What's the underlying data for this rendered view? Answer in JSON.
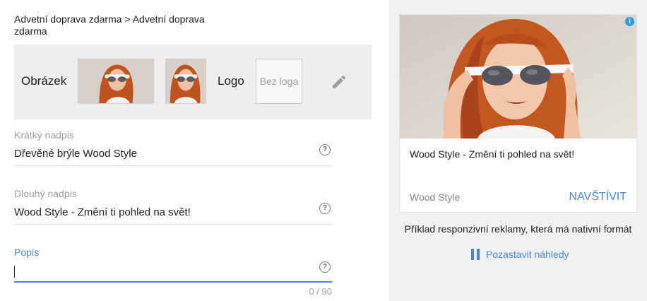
{
  "breadcrumb": "Advetní doprava zdarma > Advetní doprava zdarma",
  "images": {
    "image_label": "Obrázek",
    "logo_label": "Logo",
    "no_logo": "Bez loga",
    "edit_icon": "pencil-icon"
  },
  "fields": {
    "short_headline": {
      "label": "Krátký nadpis",
      "value": "Dřevěné brýle Wood Style"
    },
    "long_headline": {
      "label": "Dlouhý nadpis",
      "value": "Wood Style - Změní ti pohled na svět!"
    },
    "description": {
      "label": "Popis",
      "value": "",
      "counter": "0 / 90"
    },
    "help_icon": "help-icon"
  },
  "preview": {
    "info_icon": "info-icon",
    "headline": "Wood Style - Změní ti pohled na svět!",
    "business_name": "Wood Style",
    "cta": "NAVŠTÍVIT",
    "caption": "Příklad responzivní reklamy, která má nativní formát",
    "pause_label": "Pozastavit náhledy"
  },
  "colors": {
    "accent": "#4a86d8",
    "info": "#2fa0d6",
    "panel_bg": "#eeeeee",
    "preview_bg": "#f1f1f1"
  }
}
